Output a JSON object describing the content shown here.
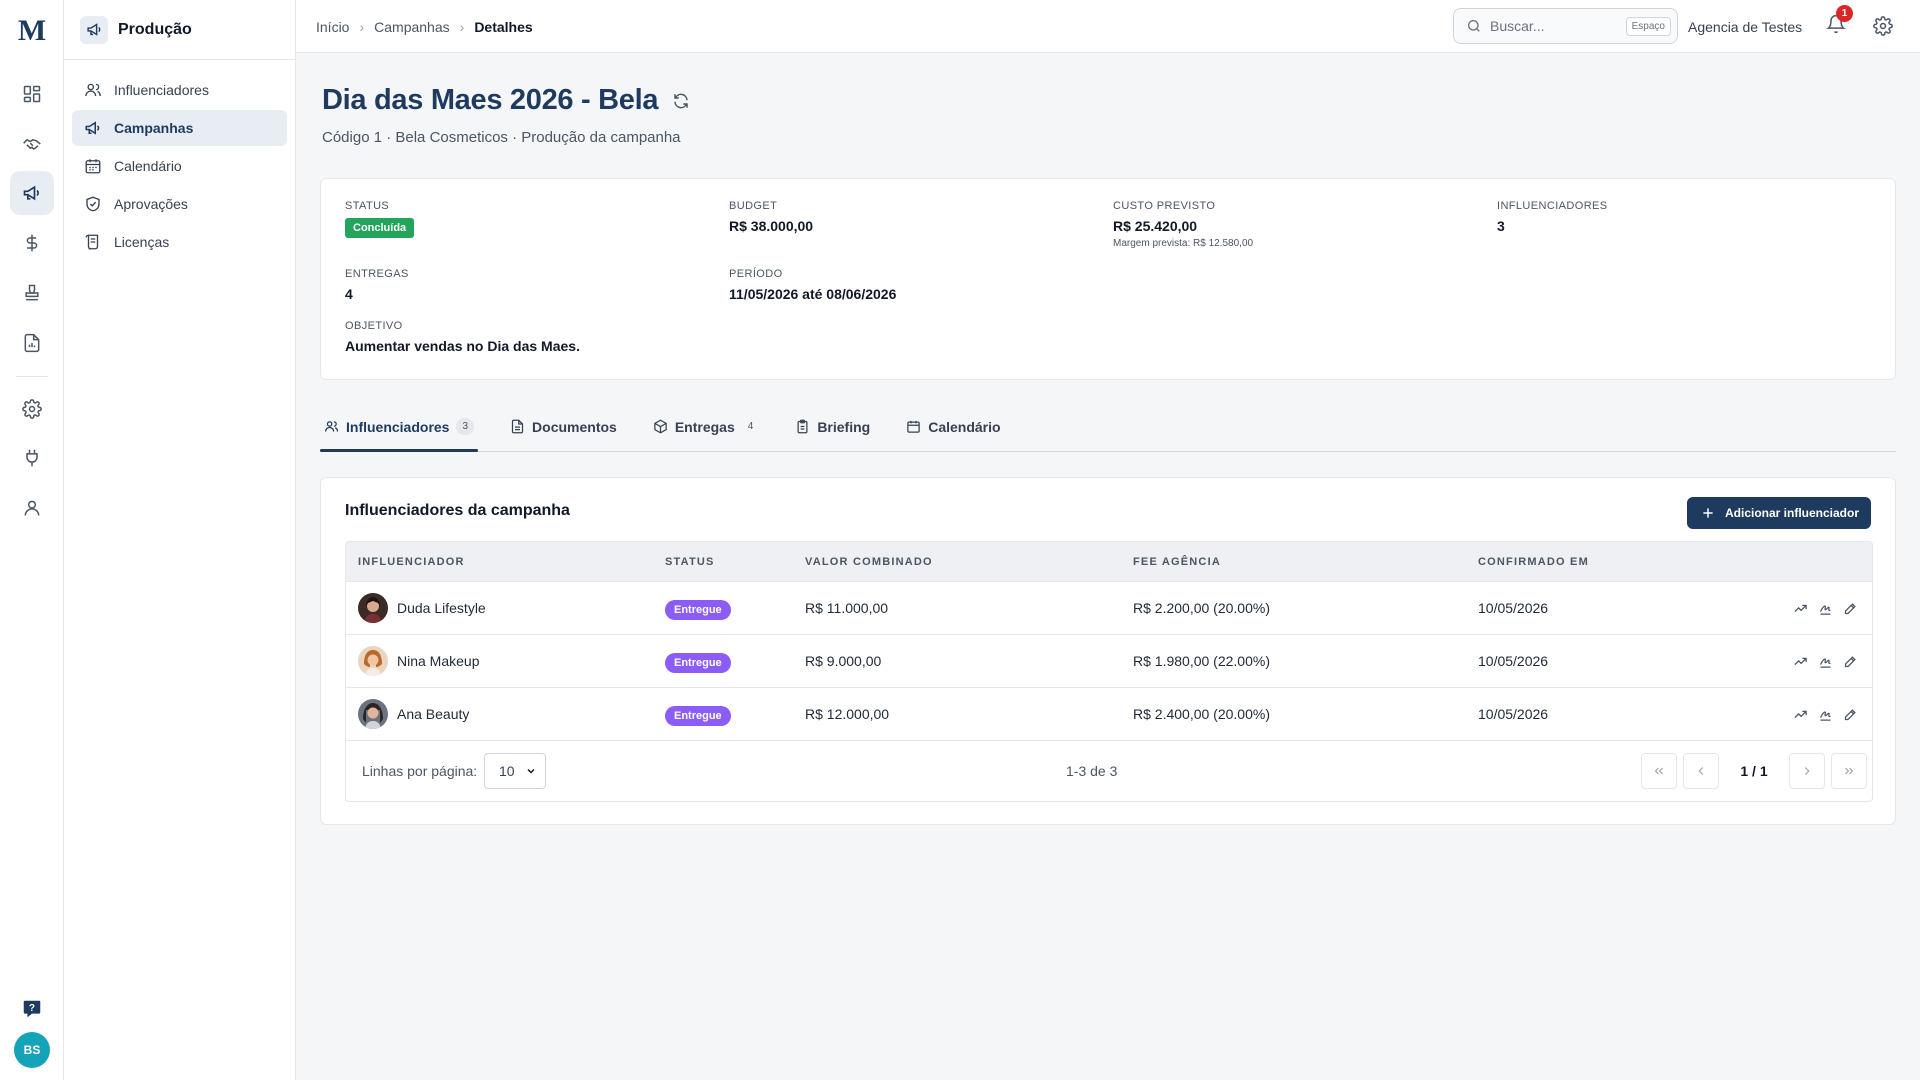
{
  "rail": {
    "logo": "M",
    "items": [
      "dashboard-icon",
      "handshake-icon",
      "megaphone-icon",
      "dollar-icon",
      "stamp-icon",
      "report-icon",
      "gear-icon",
      "plug-icon",
      "user-icon"
    ],
    "active": "megaphone-icon",
    "avatar_initials": "BS"
  },
  "sidebar": {
    "title": "Produção",
    "items": [
      {
        "label": "Influenciadores",
        "icon": "users-icon"
      },
      {
        "label": "Campanhas",
        "icon": "megaphone-icon",
        "active": true
      },
      {
        "label": "Calendário",
        "icon": "calendar-icon"
      },
      {
        "label": "Aprovações",
        "icon": "shield-check-icon"
      },
      {
        "label": "Licenças",
        "icon": "license-icon"
      }
    ]
  },
  "topbar": {
    "breadcrumb": [
      "Início",
      "Campanhas",
      "Detalhes"
    ],
    "search_placeholder": "Buscar...",
    "search_kbd": "Espaço",
    "agency": "Agencia de Testes",
    "notifications": "1"
  },
  "page": {
    "title": "Dia das Maes 2026 - Bela",
    "subtitle": "Código 1 · Bela Cosmeticos · Produção da campanha"
  },
  "info": {
    "status_label": "STATUS",
    "status_value": "Concluída",
    "budget_label": "BUDGET",
    "budget_value": "R$ 38.000,00",
    "cost_label": "CUSTO PREVISTO",
    "cost_value": "R$ 25.420,00",
    "margin": "Margem prevista: R$ 12.580,00",
    "infl_label": "INFLUENCIADORES",
    "infl_value": "3",
    "deliv_label": "ENTREGAS",
    "deliv_value": "4",
    "period_label": "PERÍODO",
    "period_value": "11/05/2026 até 08/06/2026",
    "goal_label": "OBJETIVO",
    "goal_value": "Aumentar vendas no Dia das Maes."
  },
  "tabs": [
    {
      "label": "Influenciadores",
      "count": "3",
      "active": true
    },
    {
      "label": "Documentos"
    },
    {
      "label": "Entregas",
      "count": "4"
    },
    {
      "label": "Briefing"
    },
    {
      "label": "Calendário"
    }
  ],
  "table": {
    "title": "Influenciadores da campanha",
    "add_button": "Adicionar influenciador",
    "headers": [
      "INFLUENCIADOR",
      "STATUS",
      "VALOR COMBINADO",
      "FEE AGÊNCIA",
      "CONFIRMADO EM"
    ],
    "rows": [
      {
        "name": "Duda Lifestyle",
        "status": "Entregue",
        "value": "R$ 11.000,00",
        "fee": "R$ 2.200,00 (20.00%)",
        "confirmed": "10/05/2026"
      },
      {
        "name": "Nina Makeup",
        "status": "Entregue",
        "value": "R$ 9.000,00",
        "fee": "R$ 1.980,00 (22.00%)",
        "confirmed": "10/05/2026"
      },
      {
        "name": "Ana Beauty",
        "status": "Entregue",
        "value": "R$ 12.000,00",
        "fee": "R$ 2.400,00 (20.00%)",
        "confirmed": "10/05/2026"
      }
    ],
    "rows_per_page_label": "Linhas por página:",
    "rows_per_page": "10",
    "range": "1-3 de 3",
    "page": "1 / 1"
  },
  "colors": {
    "accent": "#1e3a5f",
    "status_green": "#22a55a",
    "status_purple": "#8b5cf6"
  }
}
